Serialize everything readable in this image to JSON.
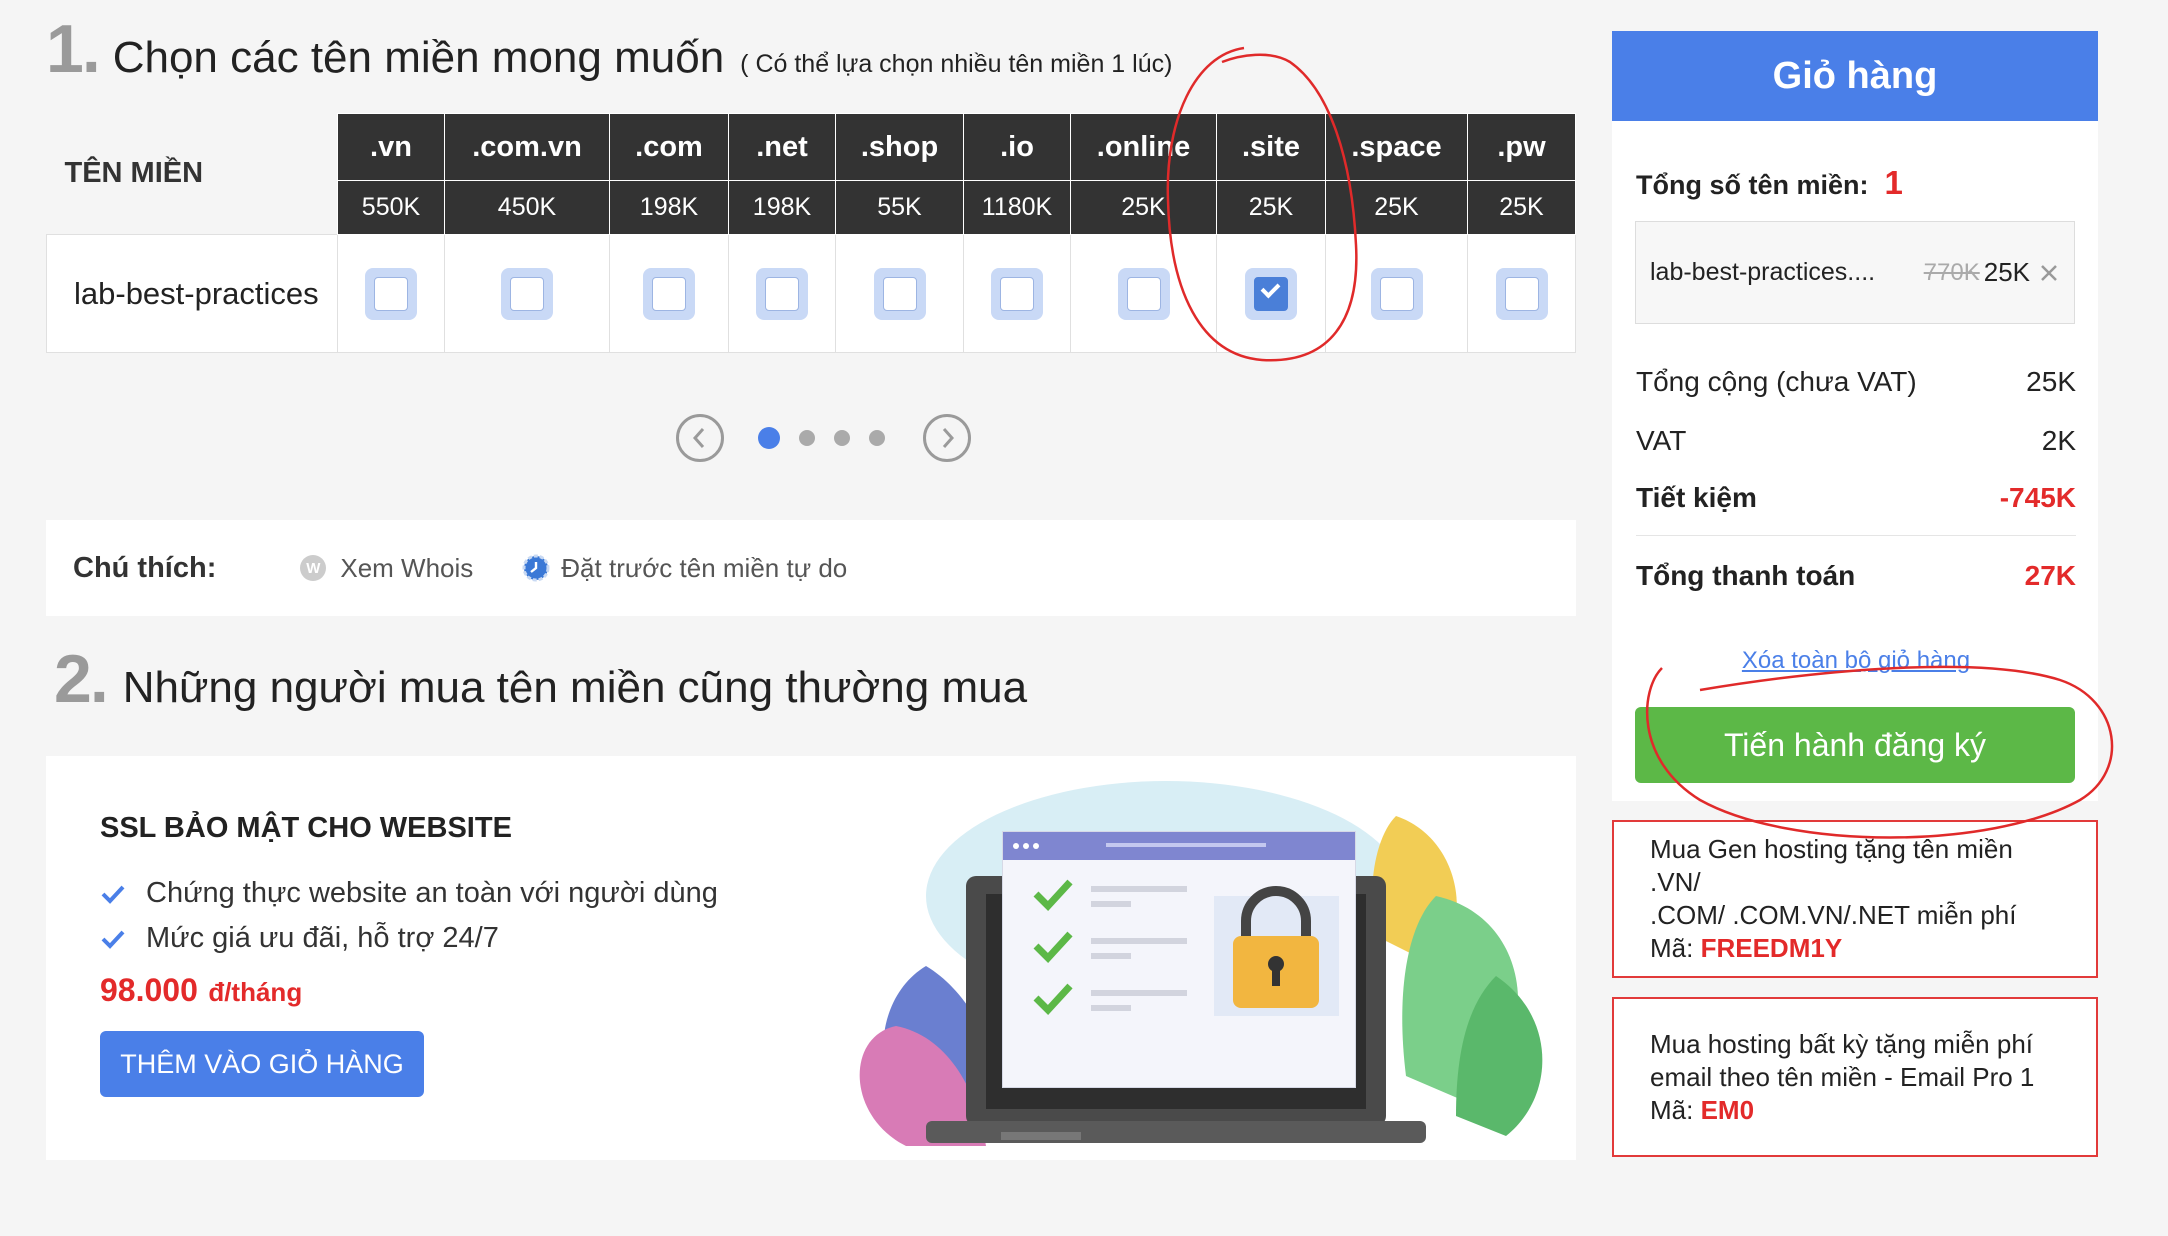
{
  "step1": {
    "number": "1.",
    "title": "Chọn các tên miền mong muốn",
    "subtitle": "( Có thể lựa chọn nhiều tên miền 1 lúc)"
  },
  "domain_table": {
    "header_label": "TÊN MIỀN",
    "domain_name": "lab-best-practices",
    "extensions": [
      {
        "ext": ".vn",
        "price": "550K",
        "checked": false
      },
      {
        "ext": ".com.vn",
        "price": "450K",
        "checked": false
      },
      {
        "ext": ".com",
        "price": "198K",
        "checked": false
      },
      {
        "ext": ".net",
        "price": "198K",
        "checked": false
      },
      {
        "ext": ".shop",
        "price": "55K",
        "checked": false
      },
      {
        "ext": ".io",
        "price": "1180K",
        "checked": false
      },
      {
        "ext": ".online",
        "price": "25K",
        "checked": false
      },
      {
        "ext": ".site",
        "price": "25K",
        "checked": true
      },
      {
        "ext": ".space",
        "price": "25K",
        "checked": false
      },
      {
        "ext": ".pw",
        "price": "25K",
        "checked": false
      }
    ]
  },
  "pager": {
    "pages": 4,
    "active": 1
  },
  "legend": {
    "title": "Chú thích:",
    "whois_icon_letter": "W",
    "whois": "Xem Whois",
    "preorder": "Đặt trước tên miền tự do"
  },
  "step2": {
    "number": "2.",
    "title": "Những người mua tên miền cũng thường mua"
  },
  "upsell": {
    "title": "SSL BẢO MẬT CHO WEBSITE",
    "features": [
      "Chứng thực website an toàn với người dùng",
      "Mức giá ưu đãi, hỗ trợ 24/7"
    ],
    "price": "98.000",
    "price_unit": "đ/tháng",
    "button": "THÊM VÀO GIỎ HÀNG"
  },
  "cart": {
    "title": "Giỏ hàng",
    "count_label": "Tổng số tên miền:",
    "count": "1",
    "item_name": "lab-best-practices....",
    "item_old_price": "770K",
    "item_price": "25K",
    "subtotal_label": "Tổng cộng (chưa VAT)",
    "subtotal": "25K",
    "vat_label": "VAT",
    "vat": "2K",
    "saving_label": "Tiết kiệm",
    "saving": "-745K",
    "total_label": "Tổng thanh toán",
    "total": "27K",
    "clear_link": "Xóa toàn bộ giỏ hàng",
    "checkout": "Tiến hành đăng ký"
  },
  "promos": [
    {
      "line1": "Mua Gen hosting tặng tên miền .VN/",
      "line2": ".COM/ .COM.VN/.NET miễn phí",
      "code_label": "Mã:",
      "code": "FREEDM1Y"
    },
    {
      "line1": "Mua hosting bất kỳ tặng miễn phí",
      "line2": "email theo tên miền - Email Pro 1",
      "code_label": "Mã:",
      "code": "EM0"
    }
  ],
  "colors": {
    "accent": "#4a7fe8",
    "success": "#5cb847",
    "danger": "#e32a2a",
    "header_dark": "#333333"
  }
}
